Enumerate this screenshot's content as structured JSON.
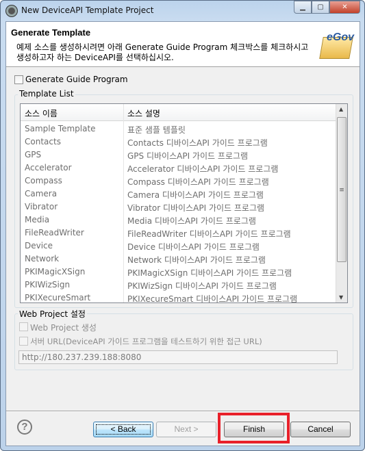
{
  "window": {
    "title": "New DeviceAPI Template Project",
    "controls": [
      "minimize",
      "maximize",
      "close"
    ]
  },
  "header": {
    "title": "Generate Template",
    "description": "예제 소스를 생성하시려면 아래 Generate Guide Program 체크박스를 체크하시고 생성하고자 하는 DeviceAPI를 선택하십시오.",
    "logo_text": "eGov"
  },
  "generate_guide": {
    "label": "Generate Guide Program",
    "checked": false
  },
  "template_list": {
    "label": "Template List",
    "columns": [
      "소스 이름",
      "소스 설명"
    ],
    "rows": [
      [
        "Sample Template",
        "표준 샘플 템플릿"
      ],
      [
        "Contacts",
        "Contacts 디바이스API 가이드 프로그램"
      ],
      [
        "GPS",
        "GPS 디바이스API 가이드 프로그램"
      ],
      [
        "Accelerator",
        "Accelerator 디바이스API 가이드 프로그램"
      ],
      [
        "Compass",
        "Compass 디바이스API 가이드 프로그램"
      ],
      [
        "Camera",
        "Camera 디바이스API 가이드 프로그램"
      ],
      [
        "Vibrator",
        "Vibrator 디바이스API 가이드 프로그램"
      ],
      [
        "Media",
        "Media 디바이스API 가이드 프로그램"
      ],
      [
        "FileReadWriter",
        "FileReadWriter 디바이스API 가이드 프로그램"
      ],
      [
        "Device",
        "Device 디바이스API 가이드 프로그램"
      ],
      [
        "Network",
        "Network 디바이스API 가이드 프로그램"
      ],
      [
        "PKIMagicXSign",
        "PKIMagicXSign 디바이스API 가이드 프로그램"
      ],
      [
        "PKIWizSign",
        "PKIWizSign 디바이스API 가이드 프로그램"
      ],
      [
        "PKIXecureSmart",
        "PKIXecureSmart 디바이스API 가이드 프로그램"
      ]
    ]
  },
  "web_project": {
    "label": "Web Project 설정",
    "create_label": "Web Project 생성",
    "server_url_label": "서버 URL(DeviceAPI 가이드 프로그램을 테스트하기 위한 접근 URL)",
    "server_url_value": "http://180.237.239.188:8080"
  },
  "buttons": {
    "back": "< Back",
    "next": "Next >",
    "finish": "Finish",
    "cancel": "Cancel"
  },
  "highlight_color": "#e8202a"
}
